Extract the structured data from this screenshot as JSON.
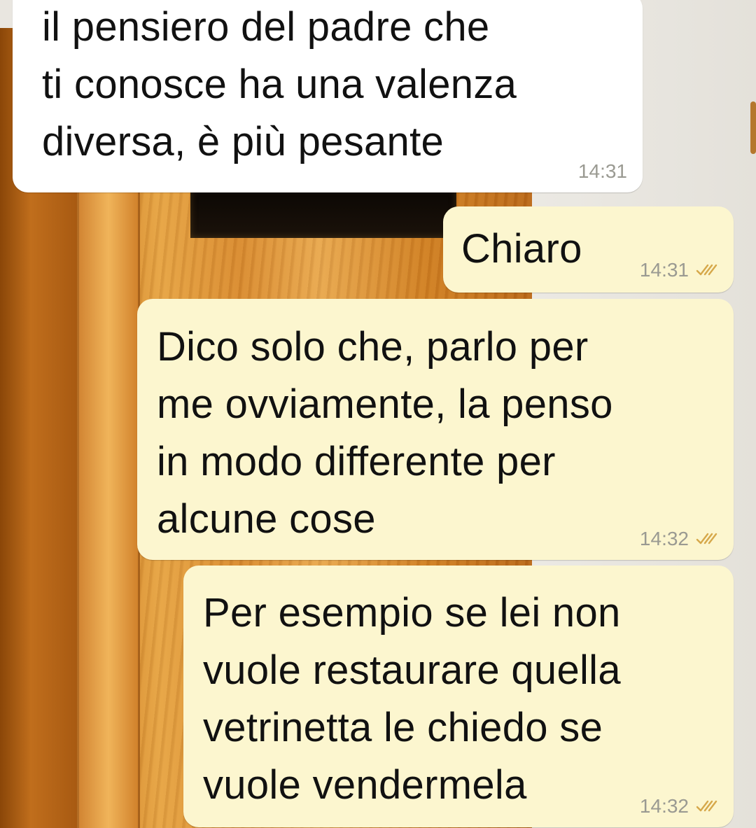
{
  "messages": [
    {
      "direction": "incoming",
      "text": "il pensiero del padre che\nti conosce ha una valenza\ndiversa, è più pesante",
      "time": "14:31"
    },
    {
      "direction": "outgoing",
      "text": "Chiaro",
      "time": "14:31",
      "status_icon": "double-check-icon"
    },
    {
      "direction": "outgoing",
      "text": "Dico solo che, parlo per\nme ovviamente, la penso\nin modo differente per\nalcune cose",
      "time": "14:32",
      "status_icon": "double-check-icon"
    },
    {
      "direction": "outgoing",
      "text": "Per esempio se lei non\nvuole restaurare quella\nvetrinetta le chiedo se\nvuole vendermela",
      "time": "14:32",
      "status_icon": "double-check-icon"
    }
  ],
  "colors": {
    "incoming_bubble": "#ffffff",
    "outgoing_bubble": "#fcf6cf",
    "timestamp": "#9a9a92",
    "read_ticks": "#d6a84a"
  }
}
